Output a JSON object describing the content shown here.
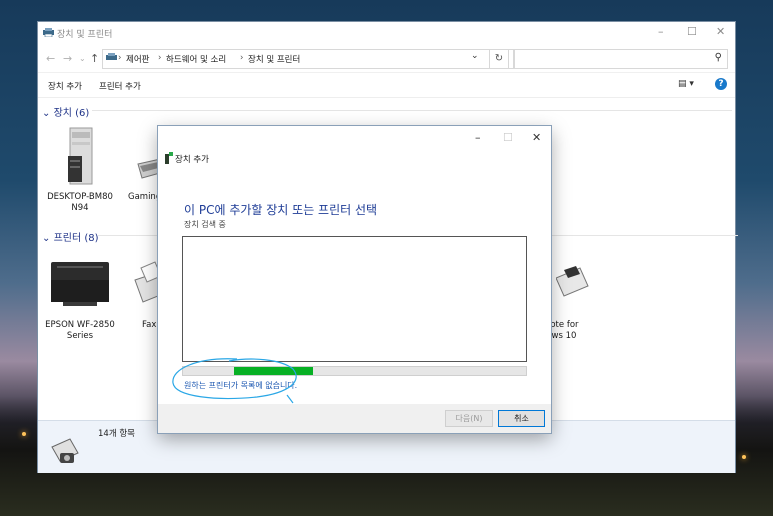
{
  "explorer": {
    "title": "장치 및 프린터",
    "window_controls": [
      "–",
      "☐",
      "✕"
    ],
    "breadcrumb": [
      "제어판",
      "하드웨어 및 소리",
      "장치 및 프린터"
    ],
    "search_placeholder": "",
    "toolbar": {
      "add_device": "장치 추가",
      "add_printer": "프린터 추가"
    },
    "groups": {
      "devices": {
        "label": "장치 (6)"
      },
      "printers": {
        "label": "프린터 (8)"
      }
    },
    "device_items": [
      {
        "label": "DESKTOP-BM80 N94",
        "icon": "computer-tower-icon"
      },
      {
        "label": "Gaming K",
        "icon": "keyboard-icon"
      }
    ],
    "printer_items": [
      {
        "label": "EPSON WF-2850 Series",
        "icon": "printer-icon"
      },
      {
        "label": "Fax",
        "icon": "fax-icon"
      },
      {
        "label": "Note for lows 10",
        "icon": "printer-icon"
      }
    ],
    "status": {
      "count": "14개 항목"
    }
  },
  "dialog": {
    "title": "장치 추가",
    "heading": "이 PC에 추가할 장치 또는 프린터 선택",
    "subheading": "장치 검색 중",
    "progress": 0.23,
    "link": "원하는 프린터가 목록에 없습니다.",
    "next_button": "다음(N)",
    "cancel_button": "취소"
  },
  "colors": {
    "accent": "#1e3c96",
    "progress": "#07b024",
    "link": "#1a56b0",
    "annotation": "#2aa7e6"
  }
}
